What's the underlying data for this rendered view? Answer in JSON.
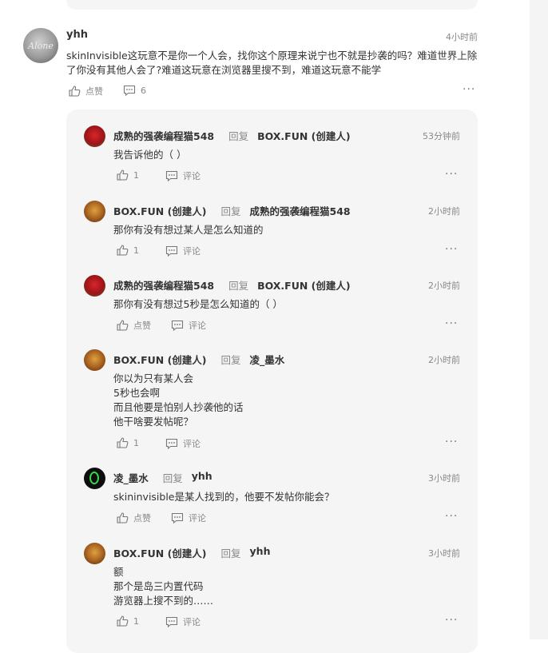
{
  "post": {
    "author": "yhh",
    "avatar_text": "Alone",
    "time": "4小时前",
    "content_line1": "skinInvisible这玩意不是你一个人会，找你这个原理来说宁也不就是抄袭的吗？难道世界上除",
    "content_line2": "了你没有其他人会了?难道这玩意在浏览器里搜不到，难道这玩意不能学",
    "like_label": "点赞",
    "comment_count": "6",
    "more": "···"
  },
  "replies": [
    {
      "author": "成熟的强袭编程猫548",
      "reply_word": "回复",
      "target": "BOX.FUN (创建人)",
      "time": "53分钟前",
      "lines": [
        "我告诉他的（ ）"
      ],
      "likes": "1",
      "comment_label": "评论",
      "avatar": "red"
    },
    {
      "author": "BOX.FUN (创建人)",
      "reply_word": "回复",
      "target": "成熟的强袭编程猫548",
      "time": "2小时前",
      "lines": [
        "那你有没有想过某人是怎么知道的"
      ],
      "likes": "1",
      "comment_label": "评论",
      "avatar": "doge"
    },
    {
      "author": "成熟的强袭编程猫548",
      "reply_word": "回复",
      "target": "BOX.FUN (创建人)",
      "time": "2小时前",
      "lines": [
        "那你有没有想过5秒是怎么知道的（ ）"
      ],
      "likes": "点赞",
      "comment_label": "评论",
      "avatar": "red"
    },
    {
      "author": "BOX.FUN (创建人)",
      "reply_word": "回复",
      "target": "凌_墨水",
      "time": "2小时前",
      "lines": [
        "你以为只有某人会",
        "5秒也会啊",
        "而且他要是怕别人抄袭他的话",
        "他干啥要发帖呢？"
      ],
      "likes": "1",
      "comment_label": "评论",
      "avatar": "doge"
    },
    {
      "author": "凌_墨水",
      "reply_word": "回复",
      "target": "yhh",
      "time": "3小时前",
      "lines": [
        "skininvisible是某人找到的，他要不发帖你能会？"
      ],
      "likes": "点赞",
      "comment_label": "评论",
      "avatar": "green"
    },
    {
      "author": "BOX.FUN (创建人)",
      "reply_word": "回复",
      "target": "yhh",
      "time": "3小时前",
      "lines": [
        "额",
        "那个是岛三内置代码",
        "游览器上搜不到的……"
      ],
      "likes": "1",
      "comment_label": "评论",
      "avatar": "doge"
    }
  ],
  "more_label": "···"
}
